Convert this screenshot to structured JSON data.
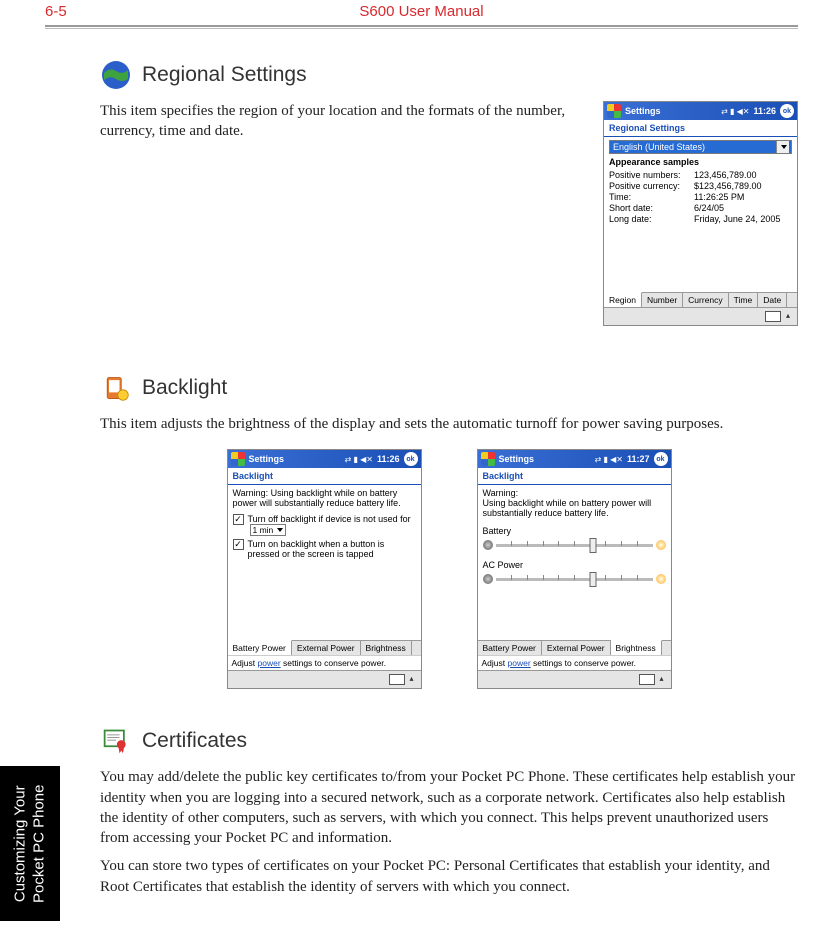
{
  "page": {
    "number": "6-5",
    "title": "S600 User Manual"
  },
  "sidebar": {
    "line1": "Customizing Your",
    "line2": "Pocket PC Phone"
  },
  "sections": {
    "regional": {
      "heading": "Regional Settings",
      "text": "This item specifies the region of your location and the formats of the number, currency, time and date."
    },
    "backlight": {
      "heading": "Backlight",
      "text": "This item adjusts the brightness of the display and sets the automatic turnoff for power saving purposes."
    },
    "certificates": {
      "heading": "Certificates",
      "p1": "You may add/delete the public key certificates to/from your Pocket PC Phone. These certificates help establish your identity when you are logging into a secured network, such as a corporate network. Certificates also help establish the identity of other computers, such as servers, with which you connect. This helps prevent unauthorized users from accessing your Pocket PC and information.",
      "p2": "You can store two types of certificates on your Pocket PC: Personal Certificates that establish your identity, and Root Certificates that establish the identity of servers with which you connect."
    }
  },
  "pda_regional": {
    "window": "Settings",
    "time": "11:26",
    "ok": "ok",
    "subhead": "Regional Settings",
    "locale": "English (United States)",
    "appearance": "Appearance samples",
    "rows": [
      {
        "lbl": "Positive numbers:",
        "val": "123,456,789.00"
      },
      {
        "lbl": "Positive currency:",
        "val": "$123,456,789.00"
      },
      {
        "lbl": "Time:",
        "val": "11:26:25 PM"
      },
      {
        "lbl": "Short date:",
        "val": "6/24/05"
      },
      {
        "lbl": "Long date:",
        "val": "Friday, June 24, 2005"
      }
    ],
    "tabs": [
      "Region",
      "Number",
      "Currency",
      "Time",
      "Date"
    ]
  },
  "pda_backlight_a": {
    "window": "Settings",
    "time": "11:26",
    "ok": "ok",
    "subhead": "Backlight",
    "warning": "Warning: Using backlight while on battery power will substantially reduce battery life.",
    "check1": "Turn off backlight if device is not used for",
    "duration": "1 min",
    "check2": "Turn on backlight when a button is pressed or the screen is tapped",
    "tabs": [
      "Battery Power",
      "External Power",
      "Brightness"
    ],
    "footer_pre": "Adjust ",
    "footer_link": "power",
    "footer_post": " settings to conserve power."
  },
  "pda_backlight_b": {
    "window": "Settings",
    "time": "11:27",
    "ok": "ok",
    "subhead": "Backlight",
    "warning_l1": "Warning:",
    "warning_l2": "Using backlight while on battery power will substantially reduce battery life.",
    "label1": "Battery",
    "label2": "AC Power",
    "tabs": [
      "Battery Power",
      "External Power",
      "Brightness"
    ],
    "footer_pre": "Adjust ",
    "footer_link": "power",
    "footer_post": " settings to conserve power."
  }
}
